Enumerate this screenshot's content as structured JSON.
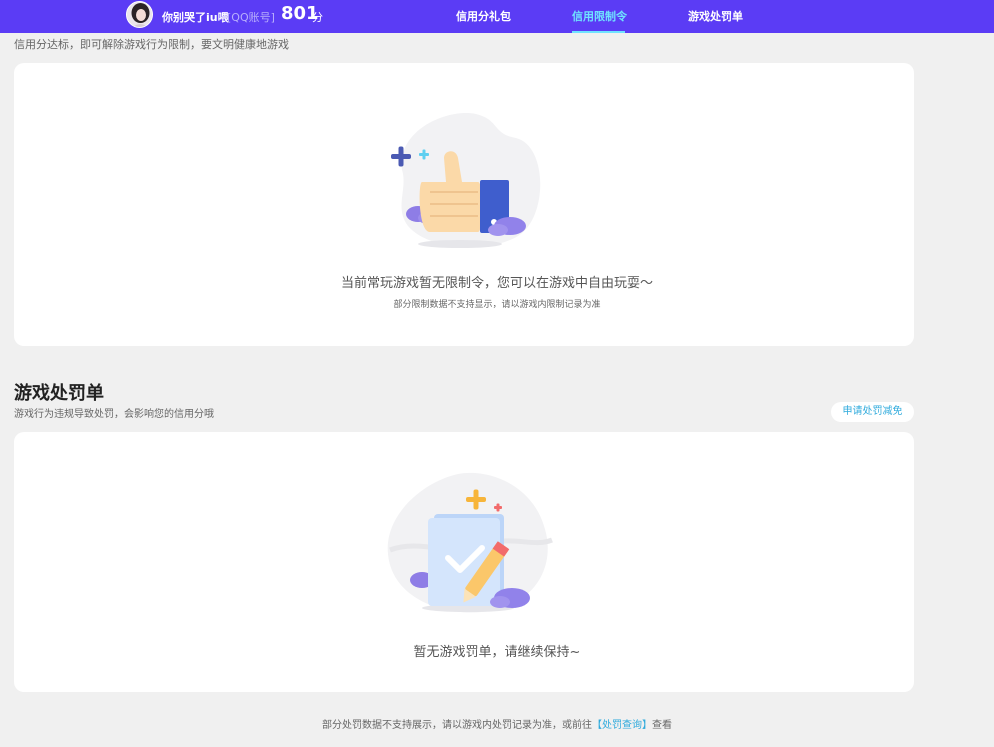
{
  "header": {
    "user_name": "你别哭了iu喂",
    "account_type": "[QQ账号]",
    "score": "801",
    "score_unit": "分",
    "tabs": [
      {
        "label": "信用分礼包",
        "active": false
      },
      {
        "label": "信用限制令",
        "active": true
      },
      {
        "label": "游戏处罚单",
        "active": false
      }
    ]
  },
  "restriction": {
    "subtitle": "信用分达标，即可解除游戏行为限制，要文明健康地游戏",
    "empty_title": "当前常玩游戏暂无限制令，您可以在游戏中自由玩耍～",
    "empty_note": "部分限制数据不支持显示，请以游戏内限制记录为准"
  },
  "penalty": {
    "title": "游戏处罚单",
    "description": "游戏行为违规导致处罚，会影响您的信用分哦",
    "appeal_label": "申请处罚减免",
    "empty_title": "暂无游戏罚单，请继续保持~"
  },
  "footer": {
    "before": "部分处罚数据不支持展示，请以游戏内处罚记录为准，或前往",
    "link": "【处罚查询】",
    "after": "查看"
  },
  "colors": {
    "header_bg": "#5b3cf5",
    "active_tab": "#6fe2ff",
    "link": "#2eaadc"
  }
}
